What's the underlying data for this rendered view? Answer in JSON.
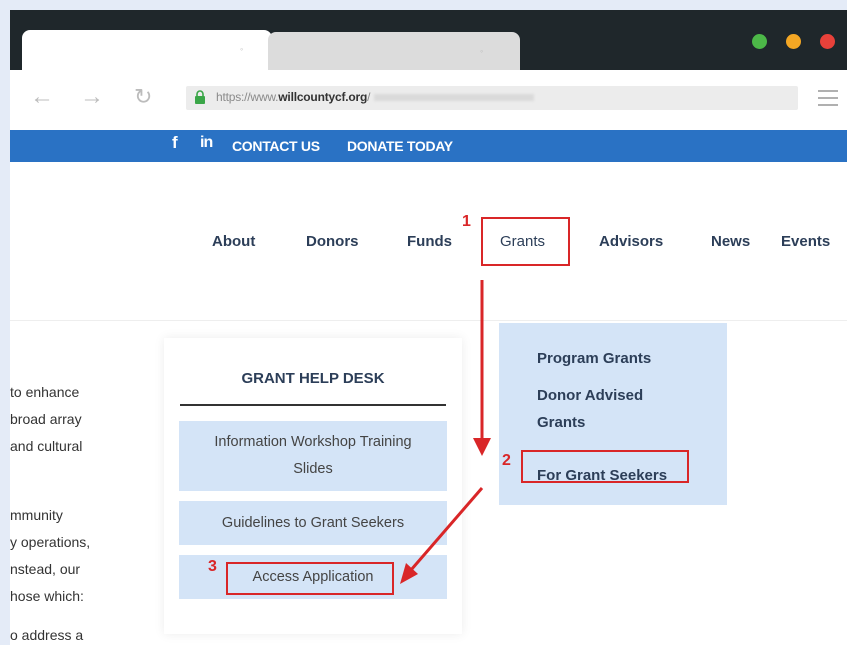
{
  "browser": {
    "url_host": "https://www.",
    "url_domain": "willcountycf.org",
    "url_rest": "/",
    "tab_icons": [
      "page-icon",
      "page-icon"
    ],
    "window_controls": {
      "colors": [
        "#4cb848",
        "#f4a724",
        "#e8413a"
      ]
    }
  },
  "topbar": {
    "social_facebook": "f",
    "social_linkedin": "in",
    "contact_us": "CONTACT US",
    "donate_today": "DONATE TODAY",
    "color": "#2a72c4"
  },
  "nav": {
    "about": "About",
    "donors": "Donors",
    "funds": "Funds",
    "grants": "Grants",
    "advisors": "Advisors",
    "news": "News",
    "events": "Events"
  },
  "body_text": [
    "to enhance",
    "broad array",
    "and cultural",
    "mmunity",
    "y operations,",
    "nstead, our",
    "hose which:",
    "o address a"
  ],
  "helpdesk": {
    "title": "GRANT HELP DESK",
    "workshop_line1": "Information Workshop Training",
    "workshop_line2": "Slides",
    "guidelines": "Guidelines to Grant Seekers",
    "access_application": "Access Application"
  },
  "dropdown": {
    "program_grants": "Program Grants",
    "donor_advised_line1": "Donor Advised",
    "donor_advised_line2": "Grants",
    "for_grant_seekers": "For Grant Seekers"
  },
  "annotations": {
    "step1": "1",
    "step2": "2",
    "step3": "3",
    "color": "#d92628"
  }
}
